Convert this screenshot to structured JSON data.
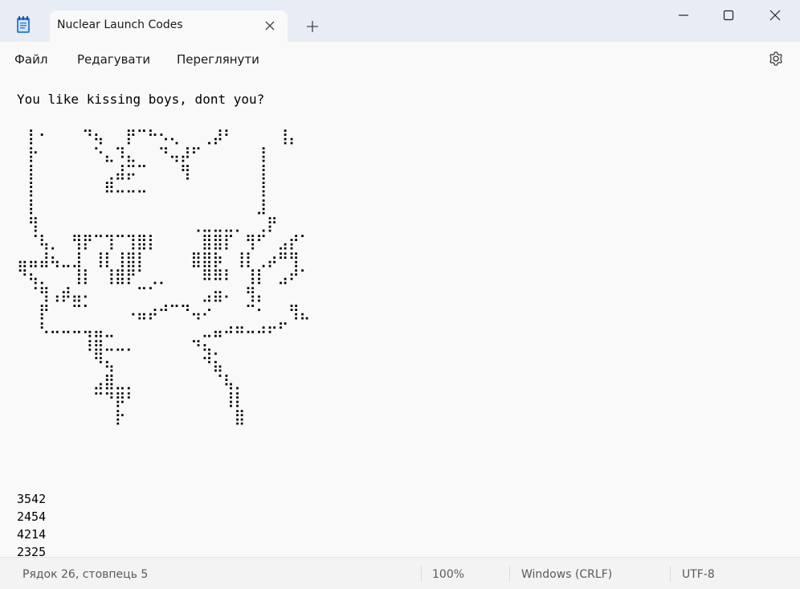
{
  "window": {
    "tab_title": "Nuclear Launch Codes"
  },
  "menu": {
    "items": [
      "Файл",
      "Редагувати",
      "Переглянути"
    ]
  },
  "icons": {
    "app": "notepad-icon",
    "tab_close": "close-icon",
    "new_tab": "plus-icon",
    "minimize": "minimize-icon",
    "maximize": "maximize-icon",
    "close": "close-icon",
    "settings": "gear-icon"
  },
  "document": {
    "first_line": "You like kissing boys, dont you?",
    "ascii_art": "⠀⡇⠂⠀⠀⠀⠙⢦⠀⠀⡟⠉⠓⠢⢄⠀⠀⢀⡼⠃⠀⠀⠀⠀⢸⡄\n⠀⡗⠀⠀⠀⠀⠀⠑⣄⠹⣄⠀⠀⠙⢤⡼⠋⠀⠀⠀⠀⠀⢸⠀\n⠀⡇⠀⠀⠀⠀⠀⠀⢀⣼⡭⠉⠀⠀⠀⢻⠀⠀⠀⠀⠀⠀⢸⠀\n⠀⡇⠀⠀⠀⠀⠀⠀⠿⠤⠤⠤⠀⠀⠀⠀⠀⠀⠀⠀⠀⠀⢸⠀\n⠀⡇⠀⠀⠀⠀⠀⠀⠀⠀⠀⠀⠀⠀⠀⠀⠀⠀⠀⠀⠀⠀⣸⠀\n⠀⢻⠀⠀⠀⠀⠀⠀⠀⠀⠀⠀⠀⠀⠀⠀⢀⣀⣀⣀⡀⠀⢀⡟⠀\n⠀⠈⢧⡀⠀⢻⡟⠉⢹⠉⢹⣿⡇⠀⠀⠀⠀⣿⣿⡏⠀⢻⠋⠀⣠⡞⠁\n⣤⣤⣼⢦⣀⣸⠀⢸⡇⢸⣿⡇⠀⠀⠀⠀⣿⣿⡷⠀⢸⡇⢀⡴⠛⢻\n⠙⢦⡀⠀⠀⢸⡇⠀⢸⣿⡟⠁⢀⡀⠀⠀⠀⠿⠿⠇⠀⢸⡇⠀⣠⠞⠁\n⠀⠈⢻⢠⡾⣤⠄⠀⠀⠀⠀⠉⠁⠀⠀⠀⠀⣠⣶⠄⠀⢻⡄\n⠀⠀⡟⠀⠀⠉⠁⠀⠀⠀⠠⣤⡴⠚⠉⠙⢤⠔⠀⠀⠀⠉⠂⠀⠀⢻⣄\n⠀⠀⠣⠤⠤⠤⢤⣤⣀⠀⠀⠀⠀⠀⠀⠀⠀⣀⣤⠴⠶⠤⠴⠖⠋\n⠀⠀⠀⠀⠀⠀⠸⣿⠤⠤⠄⠀⠀⠀⠀⠀⠙⢦⡀\n⠀⠀⠀⠀⠀⠀⠀⠙⢦⠀⠀⠀⠀⠀⠀⠀⠀⠙⣦\n⠀⠀⠀⠀⠀⠀⠀⣠⣿⣀⡀⠀⠀⠀⠀⠀⠀⠀⠈⢧⡀\n⠀⠀⠀⠀⠀⠀⠀⠉⠙⡿⠃⠀⠀⠀⠀⠀⠀⠀⠀⢸⡇\n⠀⠀⠀⠀⠀⠀⠀⠀⠀⡗⠀⠀⠀⠀⠀⠀⠀⠀⠀⠀⣿",
    "codes": [
      "3542",
      "2454",
      "4214",
      "2325"
    ]
  },
  "status": {
    "position": "Рядок 26, стовпець 5",
    "zoom": "100%",
    "line_ending": "Windows (CRLF)",
    "encoding": "UTF-8"
  }
}
